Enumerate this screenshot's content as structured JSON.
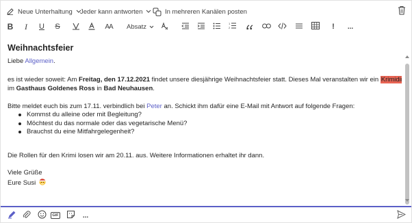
{
  "topbar": {
    "post_type": "Neue Unterhaltung",
    "reply_setting": "Jeder kann antworten",
    "multi_channel": "In mehreren Kanälen posten"
  },
  "format_toolbar": {
    "bold": "B",
    "italic": "I",
    "underline": "U",
    "strike": "S",
    "font_size": "AA",
    "paragraph": "Absatz",
    "more": "...",
    "important": "!"
  },
  "message": {
    "title": "Weihnachtsfeier",
    "greeting_prefix": "Liebe ",
    "greeting_mention": "Allgemein",
    "greeting_suffix": ".",
    "p1_a": "es ist wieder soweit: Am ",
    "p1_b": "Freitag, den 17.12.2021",
    "p1_c": " findet unsere diesjährige Weihnachtsfeier statt. Dieses Mal veranstalten wir ein ",
    "p1_d": "Krimidinner",
    "p2_a": "im ",
    "p2_b": "Gasthaus Goldenes Ross",
    "p2_c": " in ",
    "p2_d": "Bad Neuhausen",
    "p2_e": ".",
    "p3_a": "Bitte meldet euch bis zum 17.11. verbindlich bei ",
    "p3_mention": "Peter",
    "p3_b": " an. Schickt ihm dafür eine E-Mail mit Antwort auf folgende Fragen:",
    "questions": [
      "Kommst du alleine oder mit Begleitung?",
      "Möchtest du das normale oder das vegetarische Menü?",
      "Brauchst du eine Mitfahrgelegenheit?"
    ],
    "p4": "Die Rollen für den Krimi losen wir am 20.11. aus. Weitere Informationen erhaltet ihr dann.",
    "closing": "Viele Grüße",
    "signature": "Eure Susi"
  },
  "bottom_toolbar": {
    "gif_label": "GIF",
    "more": "..."
  },
  "colors": {
    "accent": "#5b5fc7",
    "highlight": "#e86454",
    "text": "#242424",
    "icon": "#424242"
  }
}
